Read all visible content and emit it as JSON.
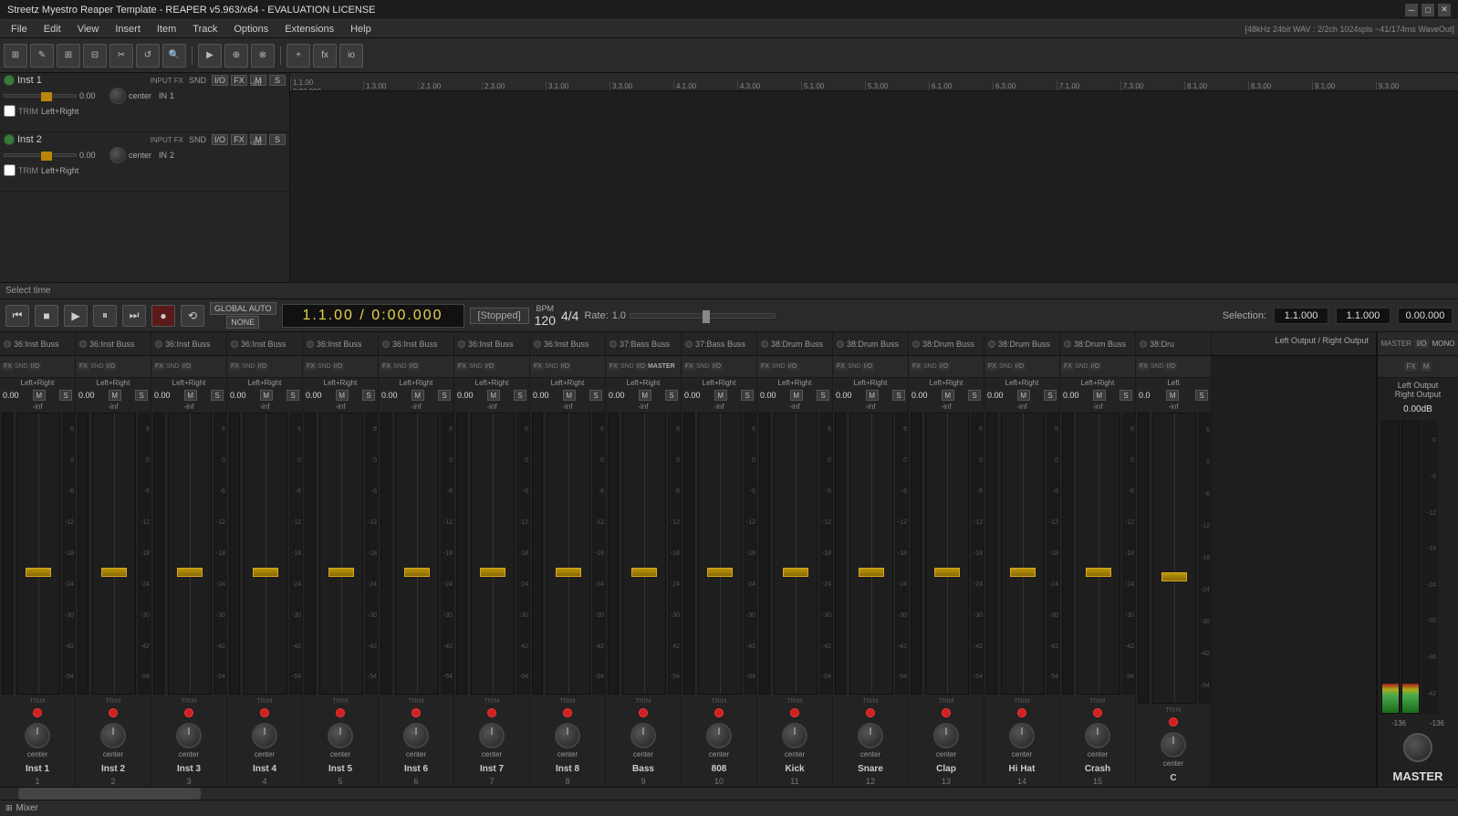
{
  "titlebar": {
    "title": "Streetz Myestro Reaper Template - REAPER v5.963/x64 - EVALUATION LICENSE",
    "info": "[48kHz 24bit WAV : 2/2ch 1024spls ~41/174ms WaveOut]"
  },
  "menu": {
    "items": [
      "File",
      "Edit",
      "View",
      "Insert",
      "Item",
      "Track",
      "Options",
      "Extensions",
      "Help"
    ]
  },
  "transport": {
    "time_display": "1.1.00 / 0:00.000",
    "status": "[Stopped]",
    "bpm_label": "BPM",
    "bpm_value": "120",
    "time_sig": "4/4",
    "rate_label": "Rate:",
    "rate_value": "1.0",
    "selection_label": "Selection:",
    "sel1": "1.1.000",
    "sel2": "1.1.000",
    "sel3": "0.00.000"
  },
  "tracks": [
    {
      "name": "Inst 1",
      "vol": "0.00",
      "pan": "center",
      "routing": "Left+Right"
    },
    {
      "name": "Inst 2",
      "vol": "0.00",
      "pan": "center",
      "routing": "Left+Right"
    }
  ],
  "select_time": "Select time",
  "buss_labels": [
    "36:Inst Buss",
    "36:Inst Buss",
    "36:Inst Buss",
    "36:Inst Buss",
    "36:Inst Buss",
    "36:Inst Buss",
    "36:Inst Buss",
    "36:Inst Buss",
    "37:Bass Buss",
    "37:Bass Buss",
    "38:Drum Buss",
    "38:Drum Buss",
    "38:Drum Buss",
    "38:Drum Buss",
    "38:Drum Buss",
    "38:Dru"
  ],
  "channels": [
    {
      "name": "Inst 1",
      "num": "1",
      "vol": "0.00",
      "routing": "Left+Right",
      "pan": "center"
    },
    {
      "name": "Inst 2",
      "num": "2",
      "vol": "0.00",
      "routing": "Left+Right",
      "pan": "center"
    },
    {
      "name": "Inst 3",
      "num": "3",
      "vol": "0.00",
      "routing": "Left+Right",
      "pan": "center"
    },
    {
      "name": "Inst 4",
      "num": "4",
      "vol": "0.00",
      "routing": "Left+Right",
      "pan": "center"
    },
    {
      "name": "Inst 5",
      "num": "5",
      "vol": "0.00",
      "routing": "Left+Right",
      "pan": "center"
    },
    {
      "name": "Inst 6",
      "num": "6",
      "vol": "0.00",
      "routing": "Left+Right",
      "pan": "center"
    },
    {
      "name": "Inst 7",
      "num": "7",
      "vol": "0.00",
      "routing": "Left+Right",
      "pan": "center"
    },
    {
      "name": "Inst 8",
      "num": "8",
      "vol": "0.00",
      "routing": "Left+Right",
      "pan": "center"
    },
    {
      "name": "Bass",
      "num": "9",
      "vol": "0.00",
      "routing": "Left+Right",
      "pan": "center"
    },
    {
      "name": "808",
      "num": "10",
      "vol": "0.00",
      "routing": "Left+Right",
      "pan": "center"
    },
    {
      "name": "Kick",
      "num": "11",
      "vol": "0.00",
      "routing": "Left+Right",
      "pan": "center"
    },
    {
      "name": "Snare",
      "num": "12",
      "vol": "0.00",
      "routing": "Left+Right",
      "pan": "center"
    },
    {
      "name": "Clap",
      "num": "13",
      "vol": "0.00",
      "routing": "Left+Right",
      "pan": "center"
    },
    {
      "name": "Hi Hat",
      "num": "14",
      "vol": "0.00",
      "routing": "Left+Right",
      "pan": "center"
    },
    {
      "name": "Crash",
      "num": "15",
      "vol": "0.00",
      "routing": "Left+Right",
      "pan": "center"
    },
    {
      "name": "C",
      "num": "",
      "vol": "0.0",
      "routing": "Left",
      "pan": "center"
    }
  ],
  "master": {
    "label": "MASTER",
    "vol": "0.00dB",
    "routing": "Left Output / Right Output",
    "pan": "center",
    "db_marks": [
      "-136",
      "-136"
    ]
  },
  "timeline": {
    "markers": [
      "1.1.00 / 0:00.000",
      "1.3.00",
      "2.1.00",
      "2.3.00",
      "3.1.00",
      "3.3.00",
      "4.1.00",
      "4.3.00",
      "5.1.00",
      "5.3.00",
      "6.1.00",
      "6.3.00",
      "7.1.00",
      "7.3.00",
      "8.1.00",
      "8.3.00",
      "9.1.00",
      "9.3.00"
    ]
  },
  "mixer_tab": {
    "icon": "⊞",
    "label": "Mixer"
  },
  "icons": {
    "play": "▶",
    "stop": "■",
    "pause": "⏸",
    "record": "●",
    "rewind": "⏮",
    "forward": "⏭",
    "loop": "⟲",
    "back": "◀◀"
  }
}
